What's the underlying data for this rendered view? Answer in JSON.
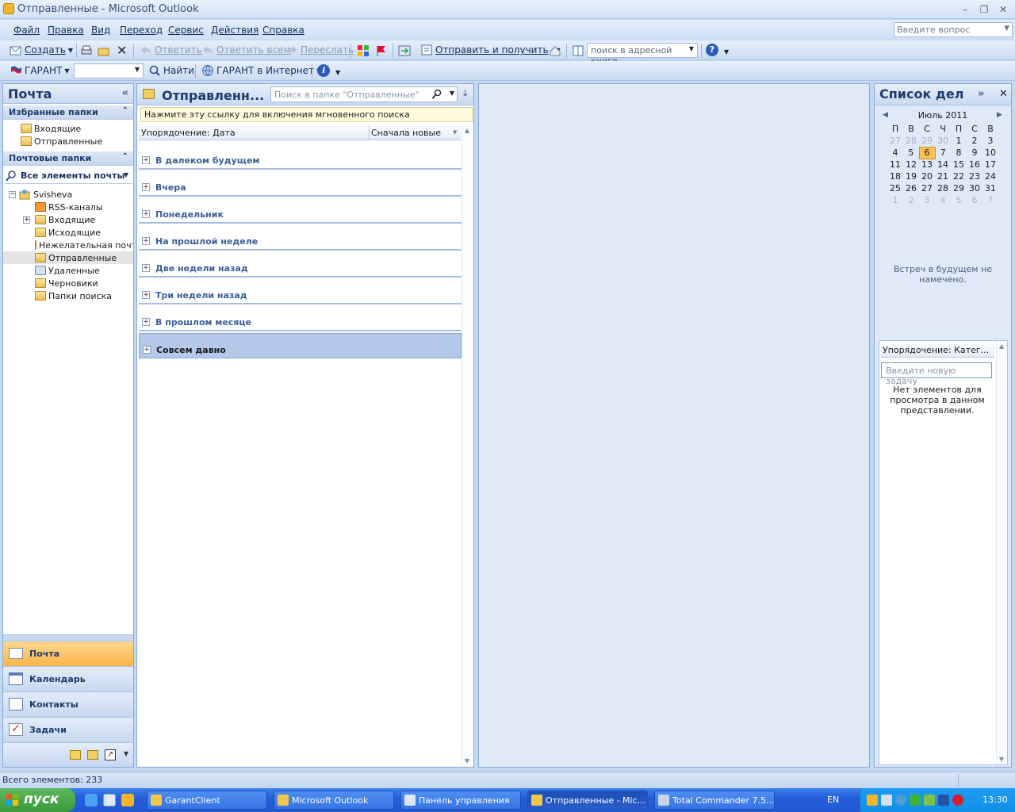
{
  "window": {
    "title": "Отправленные - Microsoft Outlook",
    "controls": [
      "minimize",
      "maximize",
      "close"
    ]
  },
  "menu": {
    "items": [
      "Файл",
      "Правка",
      "Вид",
      "Переход",
      "Сервис",
      "Действия",
      "Справка"
    ],
    "ask_placeholder": "Введите вопрос"
  },
  "toolbar1": {
    "create": "Создать",
    "reply": "Ответить",
    "reply_all": "Ответить всем",
    "forward": "Переслать",
    "send_receive": "Отправить и получить",
    "address_search": "поиск в адресной книге"
  },
  "toolbar2": {
    "garant": "ГАРАНТ",
    "find": "Найти",
    "garant_internet": "ГАРАНТ в Интернет"
  },
  "nav": {
    "title": "Почта",
    "favorites_header": "Избранные папки",
    "favorites": [
      "Входящие",
      "Отправленные"
    ],
    "mail_folders_header": "Почтовые папки",
    "all_items": "Все элементы почты",
    "root": "Svisheva",
    "folders": [
      "RSS-каналы",
      "Входящие",
      "Исходящие",
      "Нежелательная почта",
      "Отправленные",
      "Удаленные",
      "Черновики",
      "Папки поиска"
    ],
    "buttons": [
      "Почта",
      "Календарь",
      "Контакты",
      "Задачи"
    ]
  },
  "list": {
    "title": "Отправленн...",
    "search_placeholder": "Поиск в папке \"Отправленные\"",
    "instant_search_hint": "Нажмите эту ссылку для включения мгновенного поиска",
    "sort_label": "Упорядочение: Дата",
    "sort_order": "Сначала новые",
    "groups": [
      "В далеком будущем",
      "Вчера",
      "Понедельник",
      "На прошлой неделе",
      "Две недели назад",
      "Три недели назад",
      "В прошлом месяце",
      "Совсем давно"
    ],
    "selected_group": "Совсем давно"
  },
  "todo": {
    "title": "Список дел",
    "month": "Июль 2011",
    "weekdays": [
      "П",
      "В",
      "С",
      "Ч",
      "П",
      "С",
      "В"
    ],
    "weeks": [
      [
        "27",
        "28",
        "29",
        "30",
        "1",
        "2",
        "3"
      ],
      [
        "4",
        "5",
        "6",
        "7",
        "8",
        "9",
        "10"
      ],
      [
        "11",
        "12",
        "13",
        "14",
        "15",
        "16",
        "17"
      ],
      [
        "18",
        "19",
        "20",
        "21",
        "22",
        "23",
        "24"
      ],
      [
        "25",
        "26",
        "27",
        "28",
        "29",
        "30",
        "31"
      ],
      [
        "1",
        "2",
        "3",
        "4",
        "5",
        "6",
        "7"
      ]
    ],
    "today": "6",
    "no_meetings": "Встреч в будущем не намечено.",
    "task_sort": "Упорядочение: Катег...",
    "new_task_placeholder": "Введите новую задачу",
    "no_items": "Нет элементов для просмотра в данном представлении."
  },
  "status": {
    "total": "Всего элементов: 233"
  },
  "taskbar": {
    "start": "пуск",
    "tasks": [
      "GarantClient",
      "Microsoft Outlook",
      "Панель управления",
      "Отправленные - Mic...",
      "Total Commander 7.5..."
    ],
    "active_task": "Отправленные - Mic...",
    "lang": "EN",
    "clock": "13:30"
  }
}
